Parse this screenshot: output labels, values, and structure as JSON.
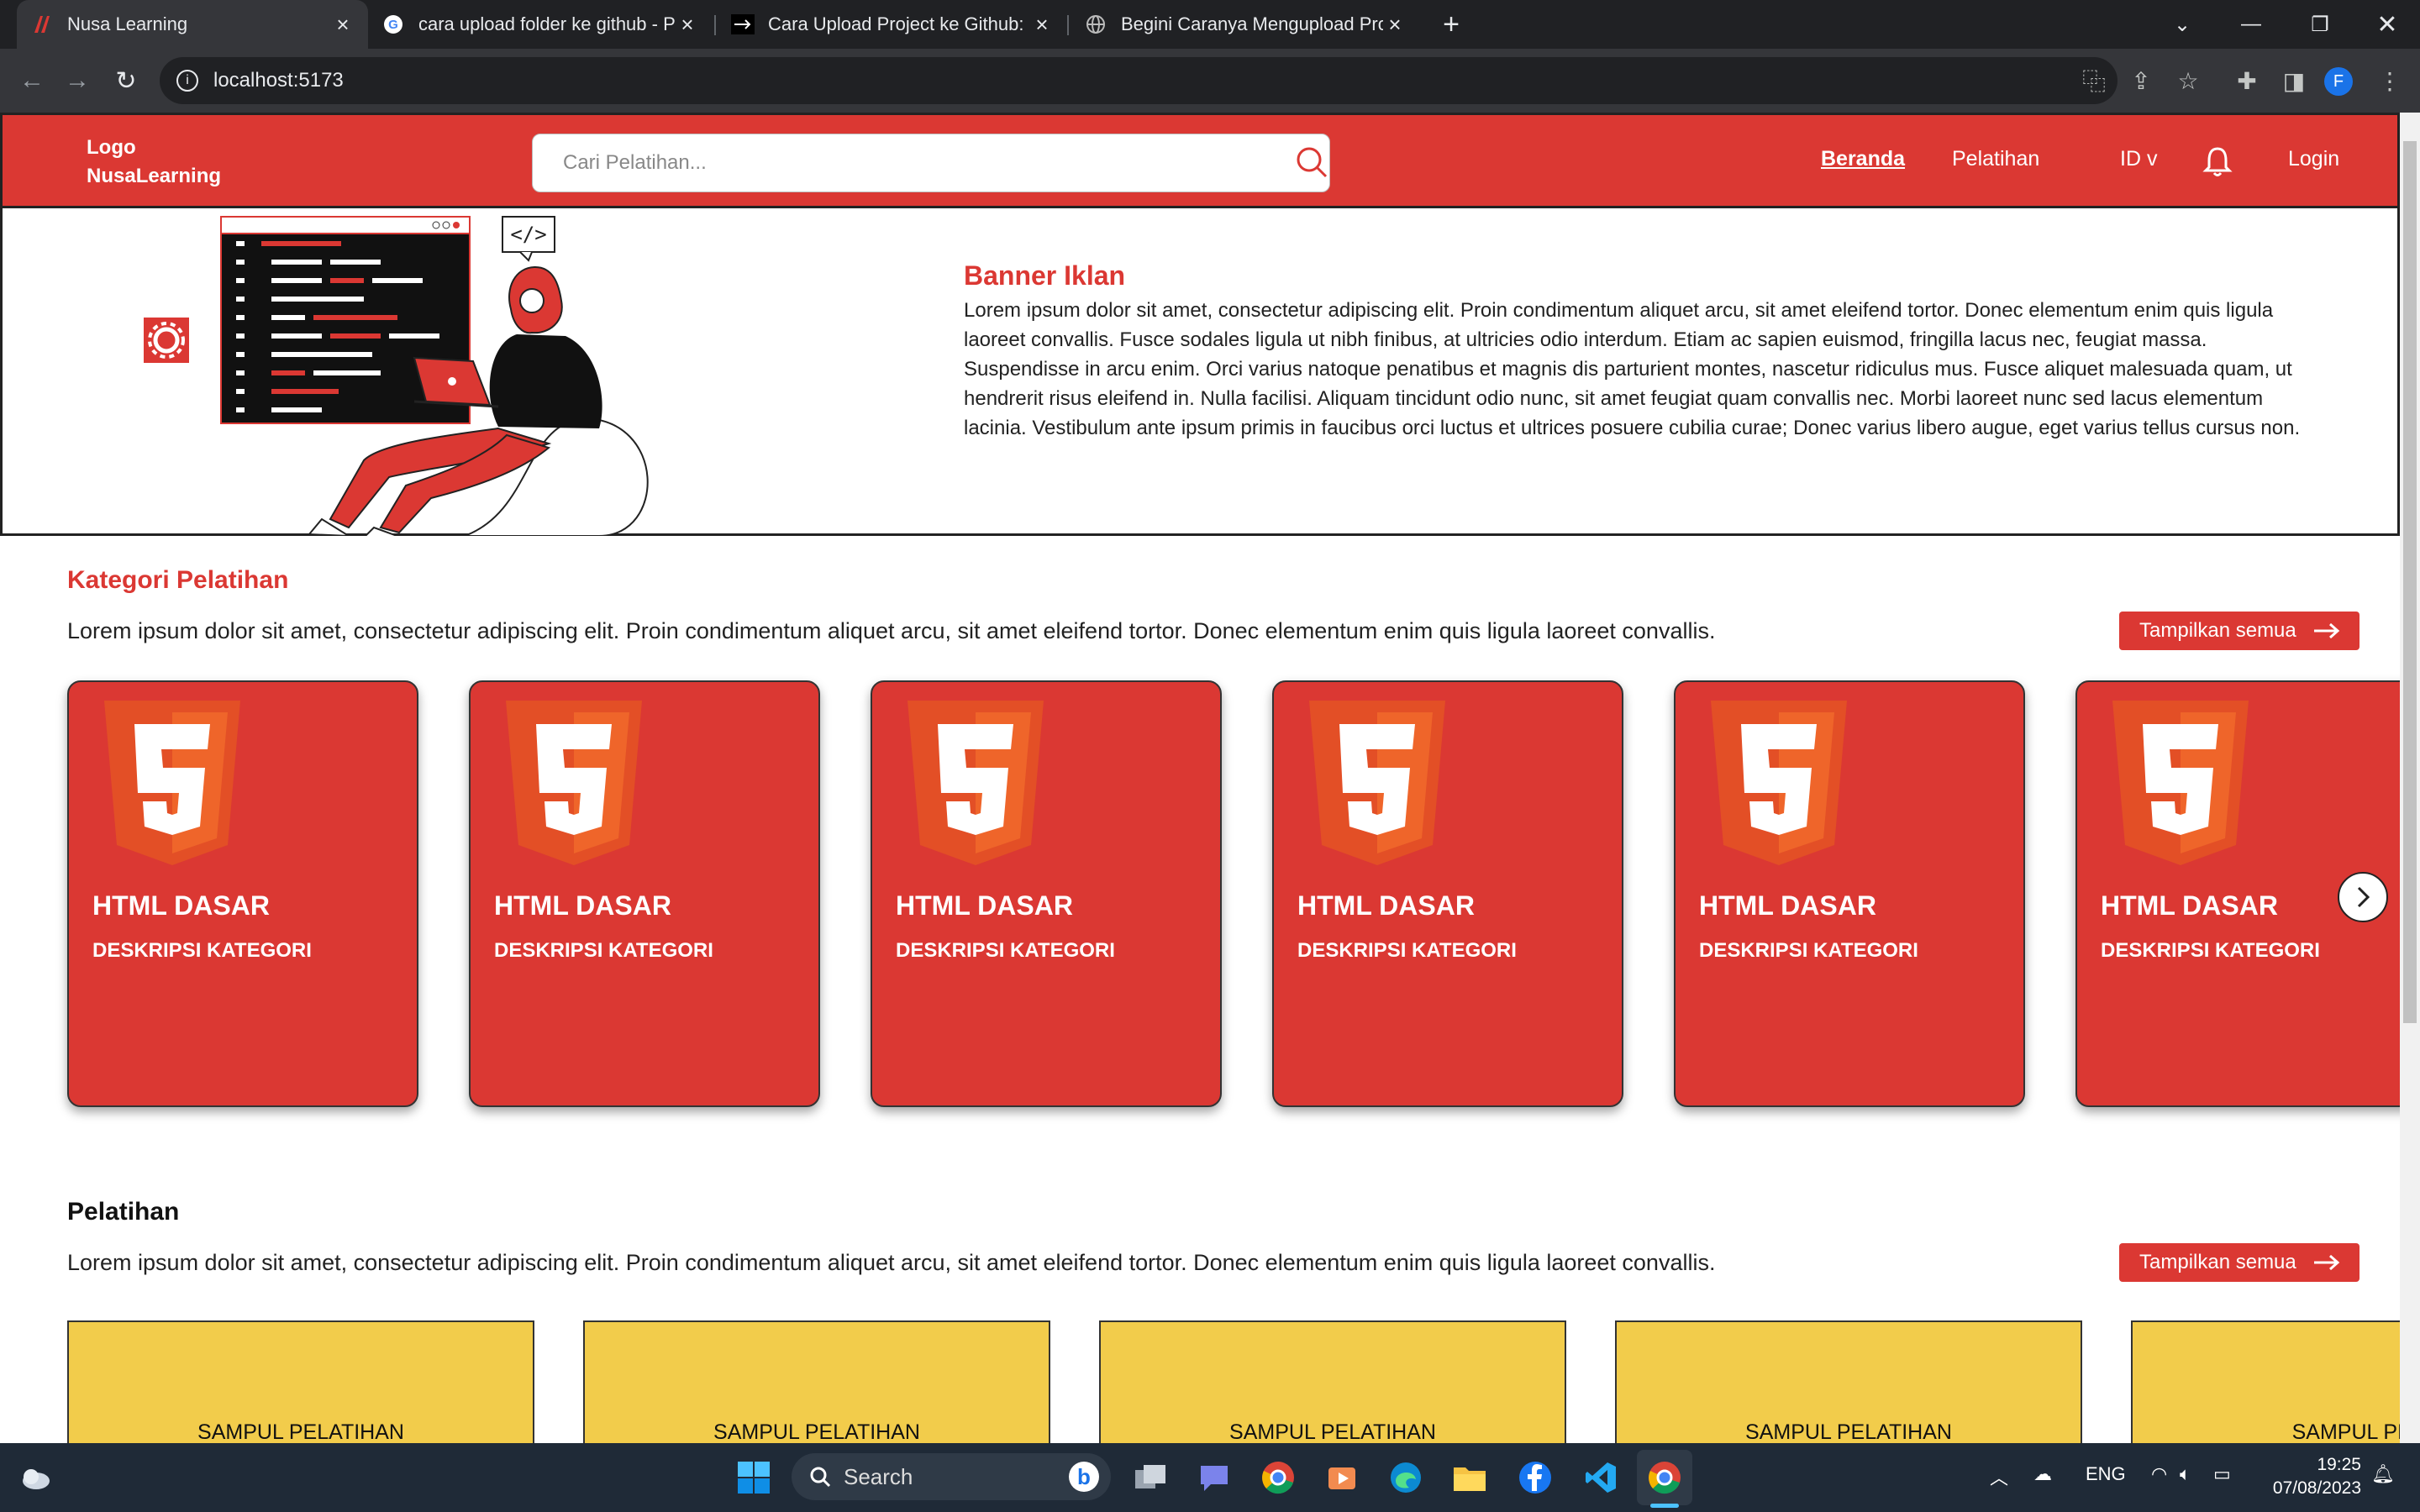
{
  "browser": {
    "tabs": [
      {
        "title": "Nusa Learning",
        "active": true
      },
      {
        "title": "cara upload folder ke github - Pe",
        "active": false
      },
      {
        "title": "Cara Upload Project ke Github: P",
        "active": false
      },
      {
        "title": "Begini Caranya Mengupload Proj",
        "active": false
      }
    ],
    "address": "localhost:5173",
    "profile_initial": "F"
  },
  "site": {
    "logo_line1": "Logo",
    "logo_line2": "NusaLearning",
    "search_placeholder": "Cari Pelatihan...",
    "nav": [
      "Beranda",
      "Pelatihan",
      "ID v",
      "Login"
    ],
    "active_nav": "Beranda"
  },
  "banner": {
    "title": "Banner Iklan",
    "text": "Lorem ipsum dolor sit amet, consectetur adipiscing elit. Proin condimentum aliquet arcu, sit amet eleifend tortor. Donec elementum enim quis ligula laoreet convallis. Fusce sodales ligula ut nibh finibus, at ultricies odio interdum. Etiam ac sapien euismod, fringilla lacus nec, feugiat massa. Suspendisse in arcu enim. Orci varius natoque penatibus et magnis dis parturient montes, nascetur ridiculus mus. Fusce aliquet malesuada quam, ut hendrerit risus eleifend in. Nulla facilisi. Aliquam tincidunt odio nunc, sit amet feugiat quam convallis nec. Morbi laoreet nunc sed lacus elementum lacinia. Vestibulum ante ipsum primis in faucibus orci luctus et ultrices posuere cubilia curae; Donec varius libero augue, eget varius tellus cursus non.",
    "code_tag": "</>"
  },
  "kategori": {
    "title": "Kategori Pelatihan",
    "desc": "Lorem ipsum dolor sit amet, consectetur adipiscing elit. Proin condimentum aliquet arcu, sit amet eleifend tortor. Donec elementum enim quis ligula laoreet convallis.",
    "show_all": "Tampilkan semua",
    "cards": [
      {
        "title": "HTML DASAR",
        "desc": "DESKRIPSI KATEGORI"
      },
      {
        "title": "HTML DASAR",
        "desc": "DESKRIPSI KATEGORI"
      },
      {
        "title": "HTML DASAR",
        "desc": "DESKRIPSI KATEGORI"
      },
      {
        "title": "HTML DASAR",
        "desc": "DESKRIPSI KATEGORI"
      },
      {
        "title": "HTML DASAR",
        "desc": "DESKRIPSI KATEGORI"
      },
      {
        "title": "HTML DASAR",
        "desc": "DESKRIPSI KATEGORI"
      }
    ]
  },
  "pelatihan": {
    "title": "Pelatihan",
    "desc": "Lorem ipsum dolor sit amet, consectetur adipiscing elit. Proin condimentum aliquet arcu, sit amet eleifend tortor. Donec elementum enim quis ligula laoreet convallis.",
    "show_all": "Tampilkan semua",
    "covers": [
      "SAMPUL PELATIHAN",
      "SAMPUL PELATIHAN",
      "SAMPUL PELATIHAN",
      "SAMPUL PELATIHAN",
      "SAMPUL PELA"
    ]
  },
  "taskbar": {
    "search": "Search",
    "lang": "ENG",
    "time": "19:25",
    "date": "07/08/2023"
  },
  "colors": {
    "brand_red": "#db3833",
    "cover_yellow": "#f2cc4b"
  }
}
